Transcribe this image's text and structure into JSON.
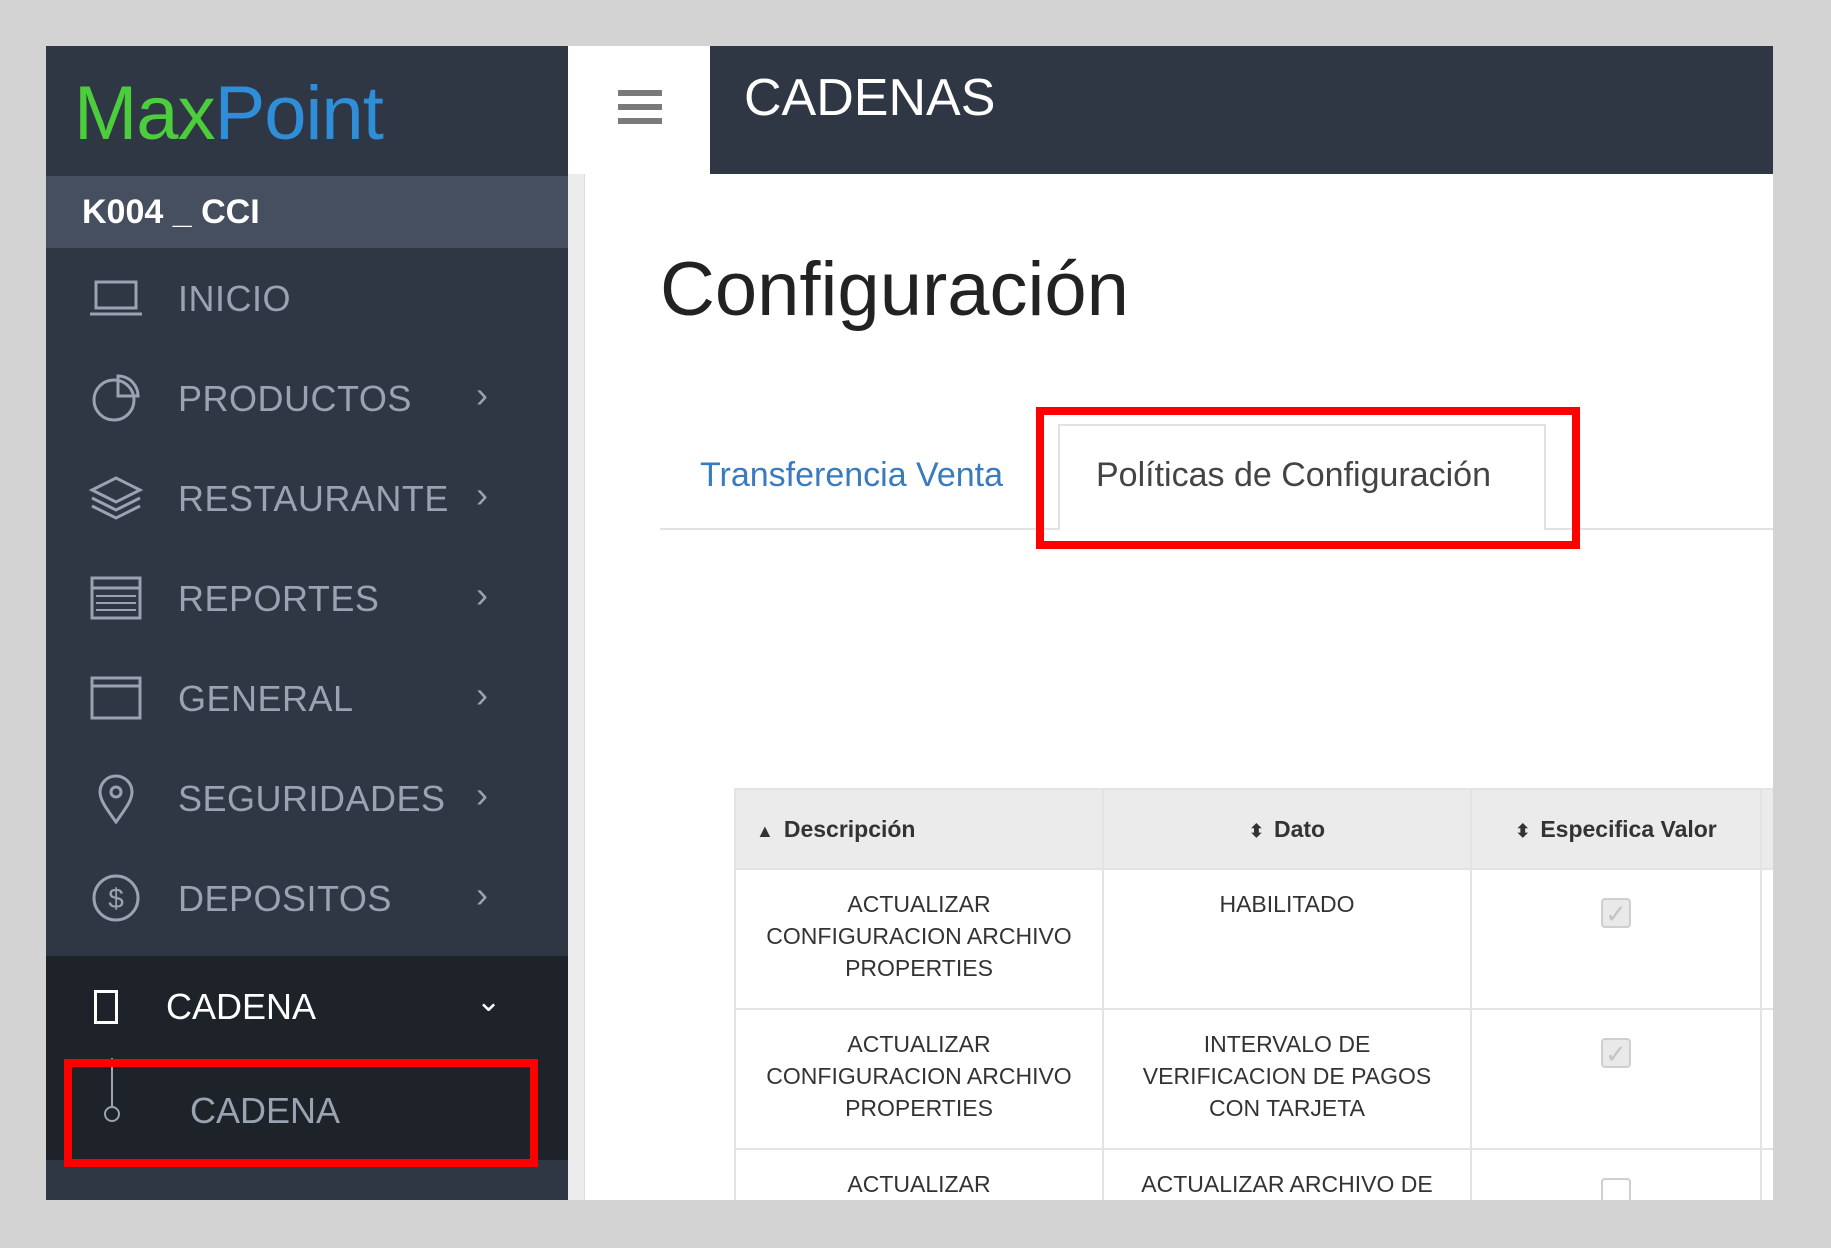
{
  "logo": {
    "part1": "Max",
    "part2": "Point"
  },
  "store": "K004 _ CCI",
  "nav": [
    {
      "label": "INICIO",
      "icon": "laptop-icon",
      "chevron": ""
    },
    {
      "label": "PRODUCTOS",
      "icon": "pie-chart-icon",
      "chevron": "›"
    },
    {
      "label": "RESTAURANTE",
      "icon": "layers-icon",
      "chevron": "›"
    },
    {
      "label": "REPORTES",
      "icon": "report-icon",
      "chevron": "›"
    },
    {
      "label": "GENERAL",
      "icon": "window-icon",
      "chevron": "›"
    },
    {
      "label": "SEGURIDADES",
      "icon": "map-pin-icon",
      "chevron": "›"
    },
    {
      "label": "DEPOSITOS",
      "icon": "dollar-icon",
      "chevron": "›"
    }
  ],
  "cadena_section": {
    "label": "CADENA",
    "chevron": "⌄",
    "sub_item": "CADENA"
  },
  "topbar": {
    "title": "CADENAS"
  },
  "page": {
    "title": "Configuración"
  },
  "tabs": [
    {
      "label": "Transferencia Venta",
      "active": false
    },
    {
      "label": "Políticas de Configuración",
      "active": true
    }
  ],
  "table": {
    "columns": [
      {
        "label": "Descripción",
        "sort": "▲"
      },
      {
        "label": "Dato",
        "sort": "⬍"
      },
      {
        "label": "Especifica Valor",
        "sort": "⬍"
      }
    ],
    "rows": [
      {
        "descripcion": [
          "ACTUALIZAR",
          "CONFIGURACION ARCHIVO",
          "PROPERTIES"
        ],
        "dato": [
          "HABILITADO"
        ],
        "especifica": true
      },
      {
        "descripcion": [
          "ACTUALIZAR",
          "CONFIGURACION ARCHIVO",
          "PROPERTIES"
        ],
        "dato": [
          "INTERVALO DE",
          "VERIFICACION DE PAGOS",
          "CON TARJETA"
        ],
        "especifica": true
      },
      {
        "descripcion": [
          "ACTUALIZAR"
        ],
        "dato": [
          "ACTUALIZAR ARCHIVO DE"
        ],
        "especifica": false
      }
    ]
  },
  "colors": {
    "sidebar": "#2f3644",
    "highlight": "#ff0000",
    "logo_green": "#4ccd3c",
    "logo_blue": "#2e8fd8"
  }
}
